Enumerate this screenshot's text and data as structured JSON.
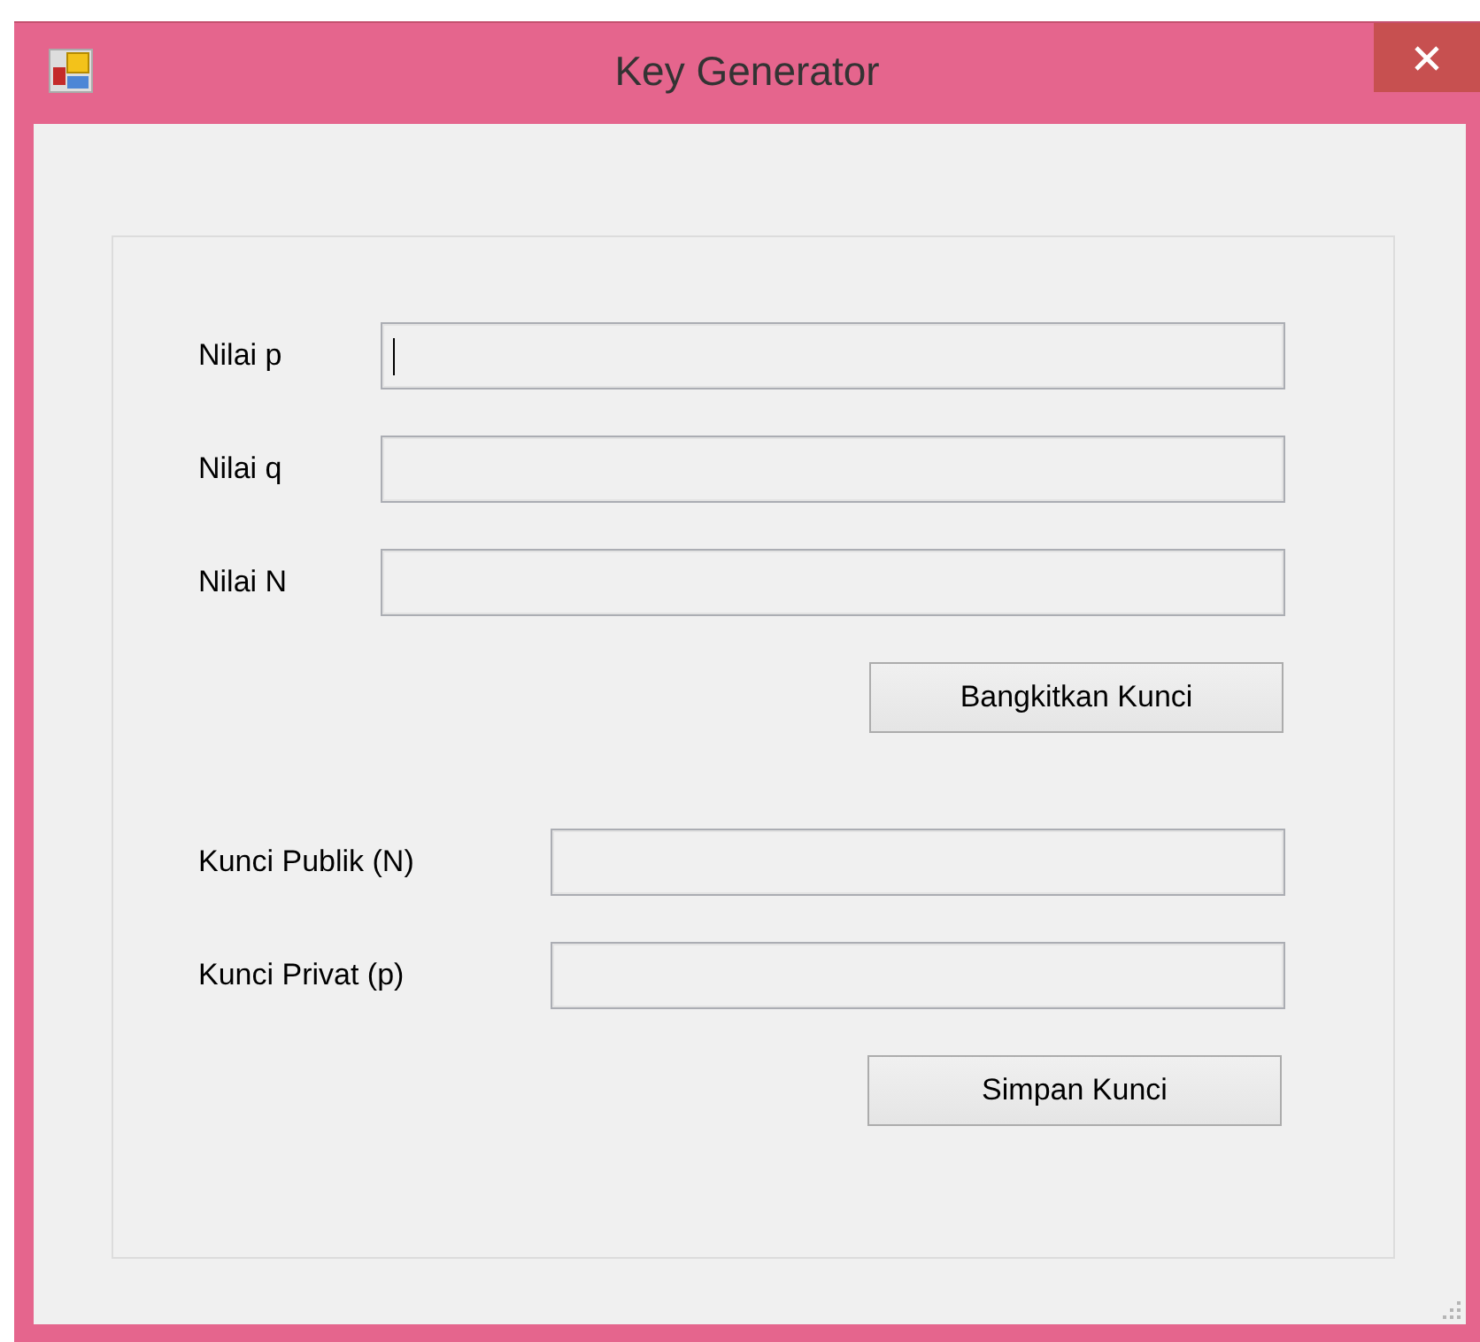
{
  "window": {
    "title": "Key Generator"
  },
  "input_fields": [
    {
      "label": "Nilai p",
      "focused": true
    },
    {
      "label": "Nilai q",
      "focused": false
    },
    {
      "label": "Nilai N",
      "focused": false
    }
  ],
  "generate_button": "Bangkitkan Kunci",
  "output_fields": [
    {
      "label": "Kunci Publik (N)",
      "focused": false
    },
    {
      "label": "Kunci Privat (p)",
      "focused": false
    }
  ],
  "save_button": "Simpan Kunci"
}
